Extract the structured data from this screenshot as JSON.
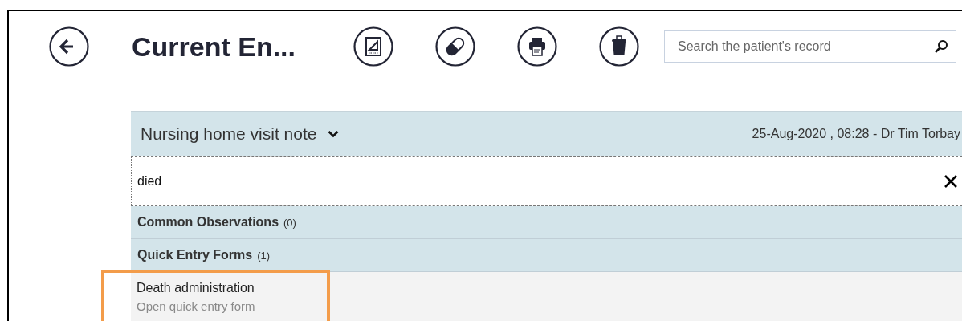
{
  "header": {
    "title": "Current En...",
    "search": {
      "placeholder": "Search the patient's record"
    }
  },
  "note": {
    "title": "Nursing home visit note",
    "meta": "25-Aug-2020 , 08:28 - Dr Tim Torbay",
    "filter": {
      "value": "died"
    }
  },
  "sections": [
    {
      "title": "Common Observations",
      "count": "(0)"
    },
    {
      "title": "Quick Entry Forms",
      "count": "(1)"
    }
  ],
  "results": [
    {
      "title": "Death administration",
      "subtitle": "Open quick entry form",
      "highlighted": true
    }
  ]
}
